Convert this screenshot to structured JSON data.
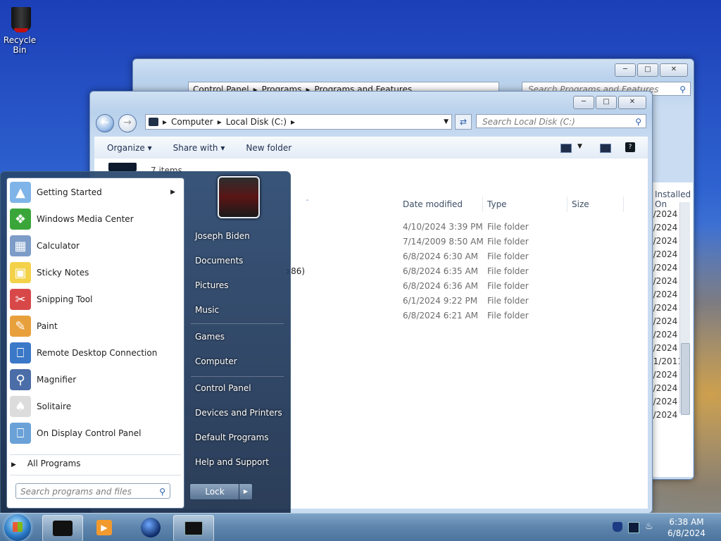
{
  "desktop": {
    "icons": [
      {
        "label": "Recycle Bin",
        "icon": "recycle-bin-icon"
      }
    ]
  },
  "back_window": {
    "path": [
      "Control Panel",
      "Programs",
      "Programs and Features"
    ],
    "search_placeholder": "Search Programs and Features",
    "installed_header": "Installed On",
    "installed_partial": [
      "1/2024",
      "1/2024",
      "1/2024",
      "1/2024",
      "1/2024",
      "1/2024",
      "1/2024",
      "1/2024",
      "2/2024",
      "2/2024",
      "2/2024",
      "11/2011",
      "2/2024",
      "1/2024",
      "1/2024",
      "2/2024"
    ]
  },
  "front_window": {
    "path": [
      "Computer",
      "Local Disk (C:)"
    ],
    "search_placeholder": "Search Local Disk (C:)",
    "toolbar": {
      "organize": "Organize",
      "share_with": "Share with",
      "new_folder": "New folder"
    },
    "item_count": "7 items",
    "columns": {
      "date_modified": "Date modified",
      "type": "Type",
      "size": "Size"
    },
    "rows": [
      {
        "name_fragment": "",
        "date": "4/10/2024 3:39 PM",
        "type": "File folder"
      },
      {
        "name_fragment": "",
        "date": "7/14/2009 8:50 AM",
        "type": "File folder"
      },
      {
        "name_fragment": "",
        "date": "6/8/2024 6:30 AM",
        "type": "File folder"
      },
      {
        "name_fragment": "x86)",
        "date": "6/8/2024 6:35 AM",
        "type": "File folder"
      },
      {
        "name_fragment": "",
        "date": "6/8/2024 6:36 AM",
        "type": "File folder"
      },
      {
        "name_fragment": "",
        "date": "6/1/2024 9:22 PM",
        "type": "File folder"
      },
      {
        "name_fragment": "",
        "date": "6/8/2024 6:21 AM",
        "type": "File folder"
      }
    ]
  },
  "start_menu": {
    "programs": [
      {
        "label": "Getting Started",
        "has_submenu": true,
        "icon": "getting-started-icon"
      },
      {
        "label": "Windows Media Center",
        "icon": "windows-media-center-icon"
      },
      {
        "label": "Calculator",
        "icon": "calculator-icon"
      },
      {
        "label": "Sticky Notes",
        "icon": "sticky-notes-icon"
      },
      {
        "label": "Snipping Tool",
        "icon": "snipping-tool-icon"
      },
      {
        "label": "Paint",
        "icon": "paint-icon"
      },
      {
        "label": "Remote Desktop Connection",
        "icon": "remote-desktop-icon"
      },
      {
        "label": "Magnifier",
        "icon": "magnifier-icon"
      },
      {
        "label": "Solitaire",
        "icon": "solitaire-icon"
      },
      {
        "label": "On Display Control Panel",
        "icon": "display-control-panel-icon"
      }
    ],
    "all_programs": "All Programs",
    "search_placeholder": "Search programs and files",
    "right_links": [
      "Joseph Biden",
      "Documents",
      "Pictures",
      "Music",
      "Games",
      "Computer",
      "Control Panel",
      "Devices and Printers",
      "Default Programs",
      "Help and Support"
    ],
    "lock_label": "Lock"
  },
  "taskbar": {
    "clock_time": "6:38 AM",
    "clock_date": "6/8/2024"
  },
  "colors": {
    "accent": "#2b5ea8",
    "taskbar": "#5f86ad"
  }
}
